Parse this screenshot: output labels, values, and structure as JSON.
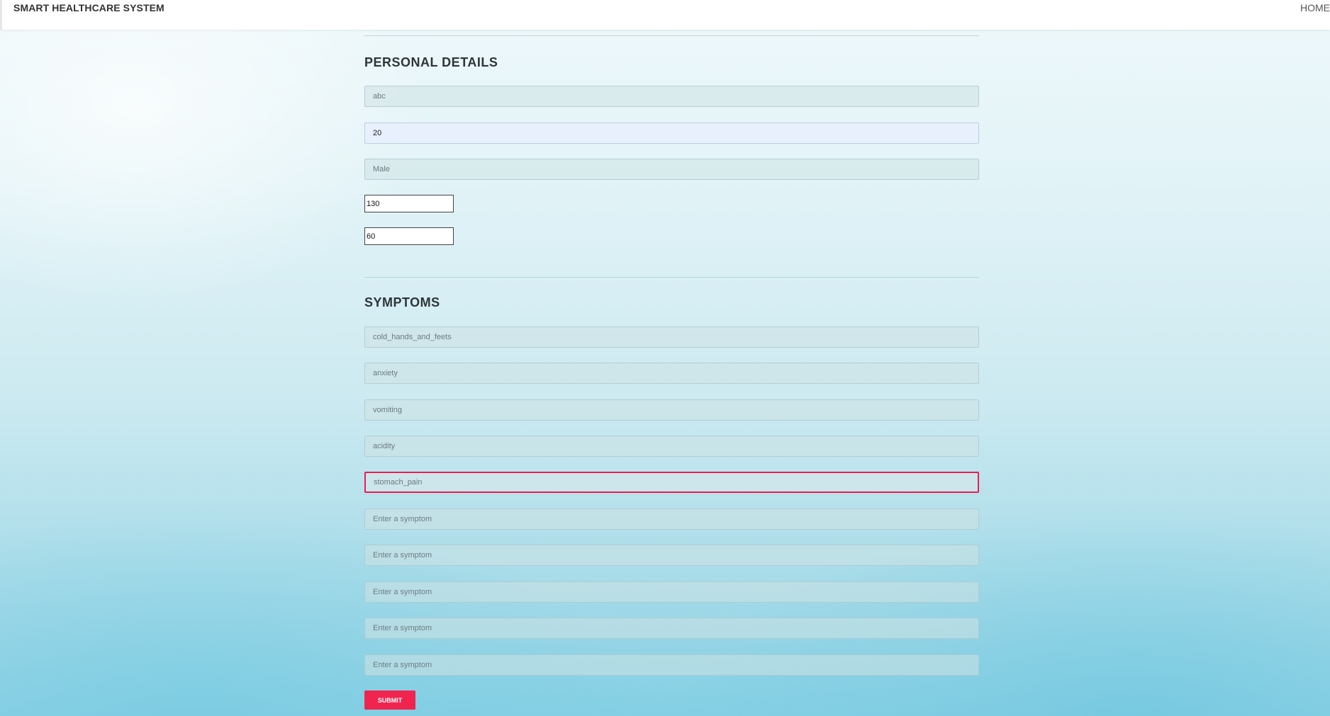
{
  "navbar": {
    "brand": "SMART HEALTHCARE SYSTEM",
    "home": "HOME"
  },
  "personal": {
    "title": "PERSONAL DETAILS",
    "name_value": "abc",
    "age_value": "20",
    "gender_value": "Male",
    "bp_value": "130",
    "weight_value": "60"
  },
  "symptoms": {
    "title": "SYMPTOMS",
    "values": [
      "cold_hands_and_feets",
      "anxiety",
      "vomiting",
      "acidity",
      "stomach_pain"
    ],
    "placeholder": "Enter a symptom"
  },
  "submit_label": "SUBMIT",
  "colors": {
    "accent": "#f0244f",
    "active_border": "#e91e4f"
  }
}
